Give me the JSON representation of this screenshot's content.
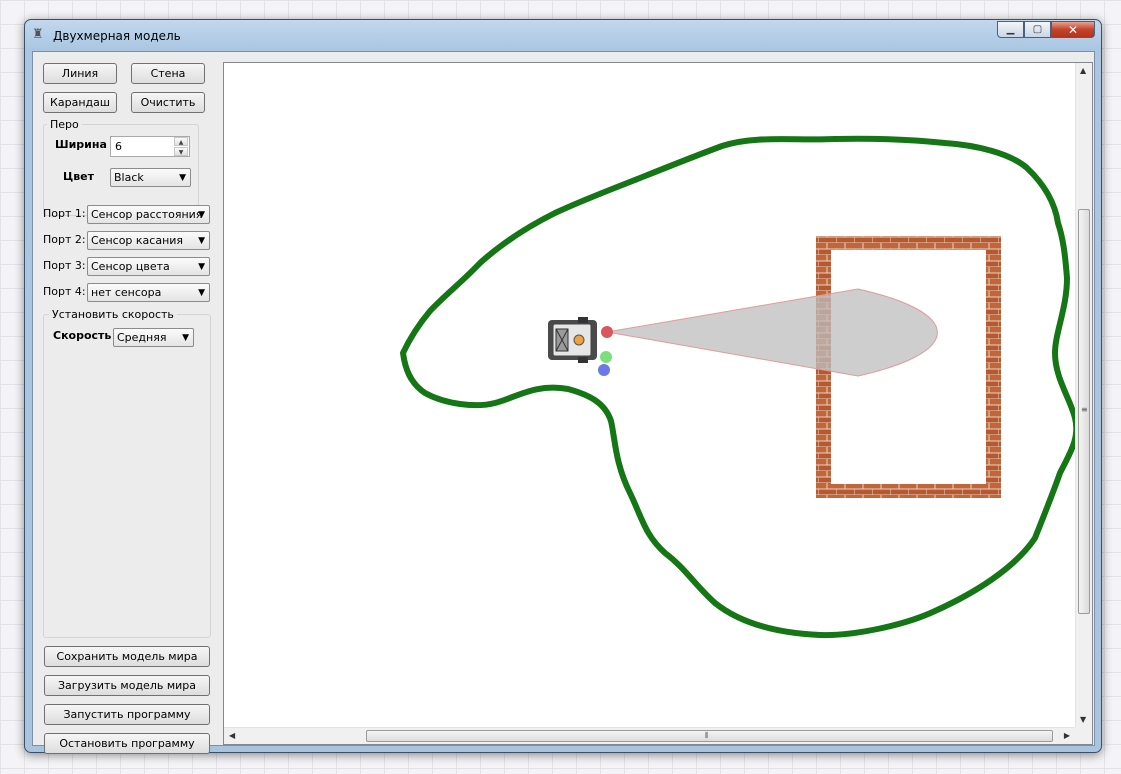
{
  "window": {
    "title": "Двухмерная модель",
    "minimize": "▁",
    "maximize": "▢",
    "close": "✕"
  },
  "tools": {
    "line": "Линия",
    "wall": "Стена",
    "pencil": "Карандаш",
    "clear": "Очистить"
  },
  "pen": {
    "group_title": "Перо",
    "width_label": "Ширина",
    "width_value": "6",
    "color_label": "Цвет",
    "color_value": "Black"
  },
  "ports": [
    {
      "label": "Порт 1:",
      "value": "Сенсор расстояния"
    },
    {
      "label": "Порт 2:",
      "value": "Сенсор касания"
    },
    {
      "label": "Порт 3:",
      "value": "Сенсор цвета"
    },
    {
      "label": "Порт 4:",
      "value": "нет сенсора"
    }
  ],
  "speed": {
    "group_title": "Установить скорость",
    "label": "Скорость",
    "value": "Средняя"
  },
  "actions": {
    "save_world": "Сохранить модель мира",
    "load_world": "Загрузить модель мира",
    "run_program": "Запустить программу",
    "stop_program": "Остановить программу"
  },
  "colors": {
    "line": "#157615",
    "wall_brick": "#b5502c",
    "sensor_cone": "#c4c4c4",
    "touch_sensor": "#d9575e",
    "color_sensor_green": "#7be07b",
    "color_sensor_blue": "#6b78e8"
  },
  "scroll_icons": {
    "up": "up-arrow-icon",
    "down": "down-arrow-icon",
    "left": "left-arrow-icon",
    "right": "right-arrow-icon"
  }
}
